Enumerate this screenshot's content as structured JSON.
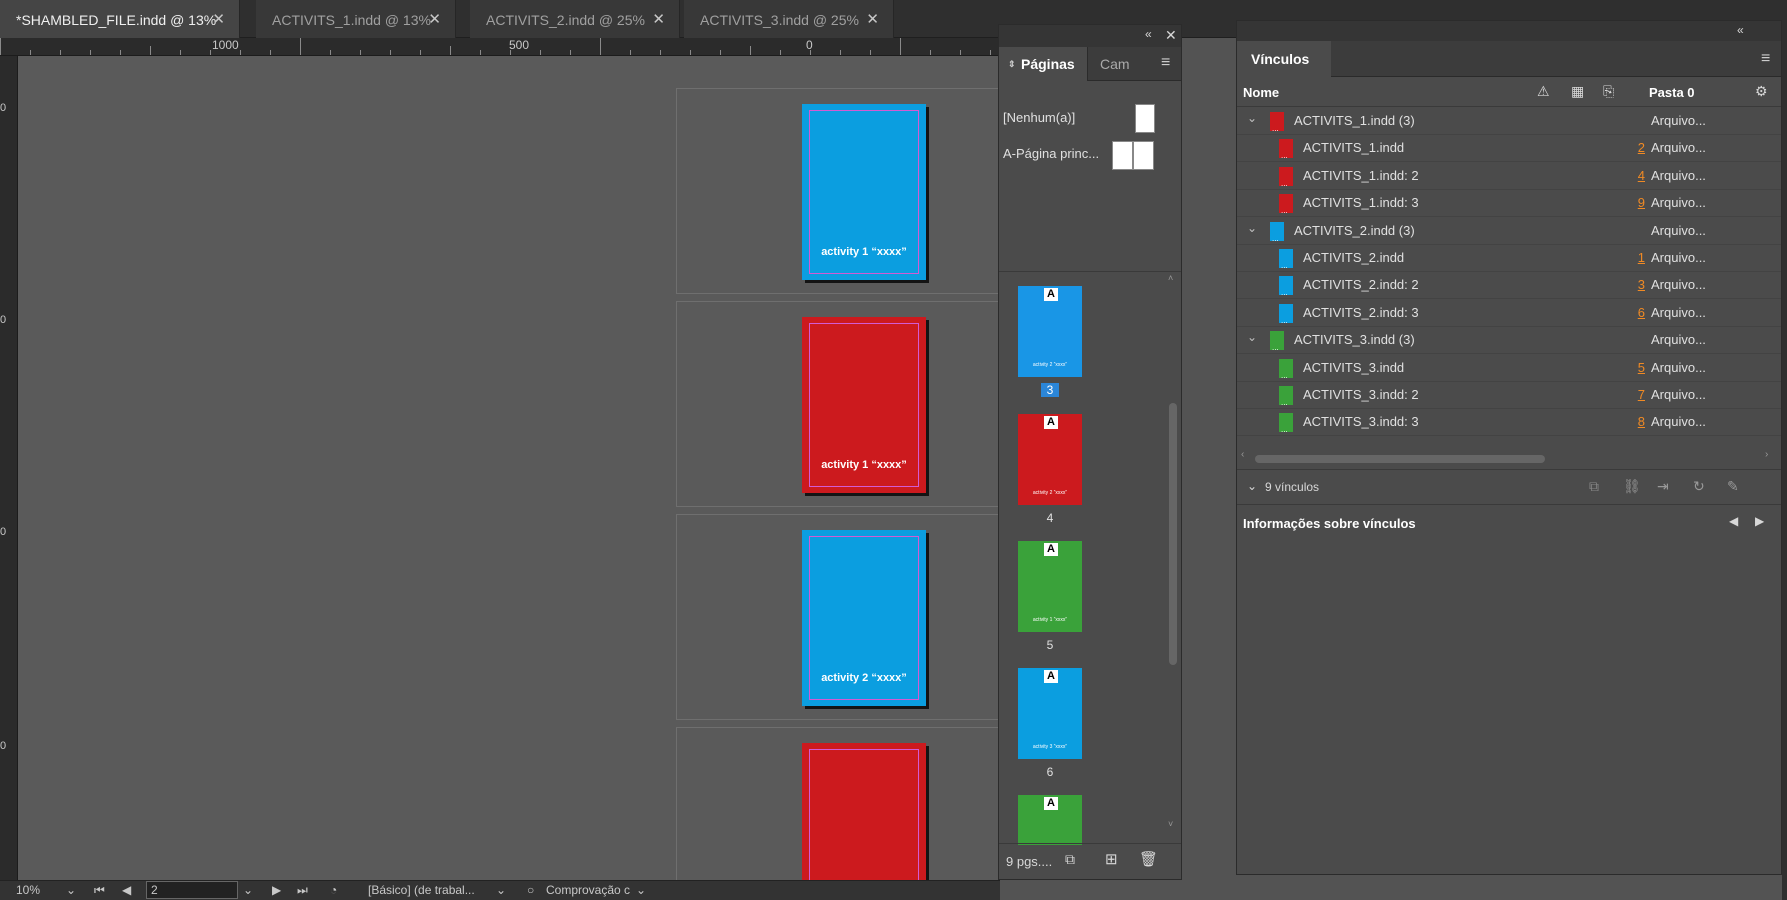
{
  "tabs": [
    {
      "label": "*SHAMBLED_FILE.indd @ 13%",
      "active": true
    },
    {
      "label": "ACTIVITS_1.indd @ 13%",
      "active": false
    },
    {
      "label": "ACTIVITS_2.indd @ 25%",
      "active": false
    },
    {
      "label": "ACTIVITS_3.indd @ 25%",
      "active": false
    }
  ],
  "ruler": {
    "labels": [
      "1000",
      "500",
      "0"
    ],
    "vlabels": [
      "0",
      "0",
      "0",
      "0"
    ]
  },
  "canvas": {
    "pages": [
      {
        "color": "#0b9ee0",
        "text": "activity 1 “xxxx”"
      },
      {
        "color": "#cc1a1e",
        "text": "activity 1 “xxxx”"
      },
      {
        "color": "#0b9ee0",
        "text": "activity 2 “xxxx”"
      },
      {
        "color": "#cc1a1e",
        "text": ""
      }
    ]
  },
  "statusbar": {
    "zoom": "10%",
    "page": "2",
    "profile": "[Básico] (de trabal...",
    "preflight": "Comprovação c"
  },
  "pages_panel": {
    "tab_pages": "Páginas",
    "tab_layers": "Cam",
    "master_none": "[Nenhum(a)]",
    "master_a": "A-Página princ...",
    "thumbs": [
      {
        "label": "A",
        "color": "#1996e6",
        "num": "3",
        "selected": true,
        "text": "activity 2 “xxxx”"
      },
      {
        "label": "A",
        "color": "#cc1a1e",
        "num": "4",
        "selected": false,
        "text": "activity 2 “xxxx”"
      },
      {
        "label": "A",
        "color": "#3aa23a",
        "num": "5",
        "selected": false,
        "text": "activity 1 “xxxx”"
      },
      {
        "label": "A",
        "color": "#0b9ee0",
        "num": "6",
        "selected": false,
        "text": "activity 3 “xxxx”"
      },
      {
        "label": "A",
        "color": "#3aa23a",
        "num": "",
        "selected": false,
        "text": ""
      }
    ],
    "footer": "9 pgs...."
  },
  "links_panel": {
    "title": "Vínculos",
    "col_name": "Nome",
    "col_folder": "Pasta 0",
    "rows": [
      {
        "name": "ACTIVITS_1.indd (3)",
        "page": "",
        "status": "Arquivo...",
        "color": "#cc1a1e",
        "group": true
      },
      {
        "name": "ACTIVITS_1.indd",
        "page": "2",
        "status": "Arquivo...",
        "color": "#cc1a1e",
        "group": false
      },
      {
        "name": "ACTIVITS_1.indd: 2",
        "page": "4",
        "status": "Arquivo...",
        "color": "#cc1a1e",
        "group": false
      },
      {
        "name": "ACTIVITS_1.indd: 3",
        "page": "9",
        "status": "Arquivo...",
        "color": "#cc1a1e",
        "group": false
      },
      {
        "name": "ACTIVITS_2.indd (3)",
        "page": "",
        "status": "Arquivo...",
        "color": "#0b9ee0",
        "group": true
      },
      {
        "name": "ACTIVITS_2.indd",
        "page": "1",
        "status": "Arquivo...",
        "color": "#0b9ee0",
        "group": false
      },
      {
        "name": "ACTIVITS_2.indd: 2",
        "page": "3",
        "status": "Arquivo...",
        "color": "#0b9ee0",
        "group": false
      },
      {
        "name": "ACTIVITS_2.indd: 3",
        "page": "6",
        "status": "Arquivo...",
        "color": "#0b9ee0",
        "group": false
      },
      {
        "name": "ACTIVITS_3.indd (3)",
        "page": "",
        "status": "Arquivo...",
        "color": "#3aa23a",
        "group": true
      },
      {
        "name": "ACTIVITS_3.indd",
        "page": "5",
        "status": "Arquivo...",
        "color": "#3aa23a",
        "group": false
      },
      {
        "name": "ACTIVITS_3.indd: 2",
        "page": "7",
        "status": "Arquivo...",
        "color": "#3aa23a",
        "group": false
      },
      {
        "name": "ACTIVITS_3.indd: 3",
        "page": "8",
        "status": "Arquivo...",
        "color": "#3aa23a",
        "group": false
      }
    ],
    "count": "9 vínculos",
    "info_title": "Informações sobre vínculos"
  }
}
